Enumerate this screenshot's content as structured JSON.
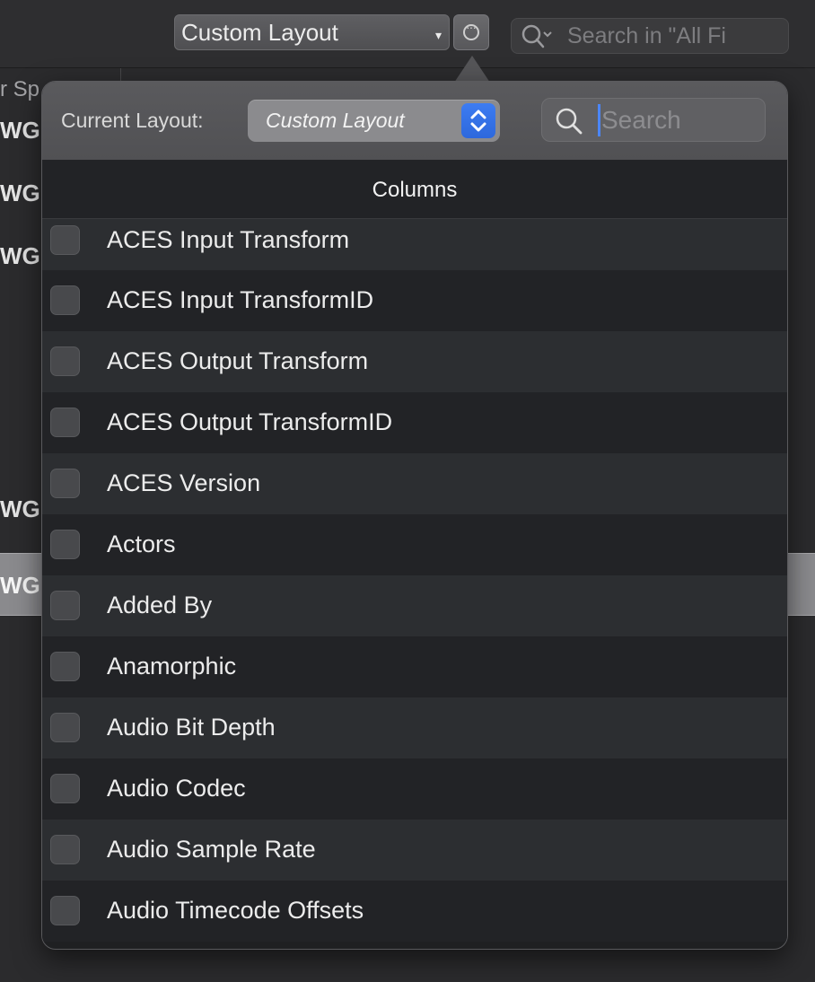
{
  "toolbar": {
    "layout_popup_label": "Custom Layout",
    "search_placeholder": "Search in \"All Fi"
  },
  "background_table": {
    "header_fragment": "r Sp",
    "cells": [
      "WG",
      "WG",
      "WG",
      "WG",
      "WG"
    ]
  },
  "popover": {
    "current_layout_label": "Current Layout:",
    "layout_value": "Custom Layout",
    "search_placeholder": "Search",
    "columns_title": "Columns",
    "items": [
      {
        "label": "ACES Input Transform",
        "checked": false
      },
      {
        "label": "ACES Input TransformID",
        "checked": false
      },
      {
        "label": "ACES Output Transform",
        "checked": false
      },
      {
        "label": "ACES Output TransformID",
        "checked": false
      },
      {
        "label": "ACES Version",
        "checked": false
      },
      {
        "label": "Actors",
        "checked": false
      },
      {
        "label": "Added By",
        "checked": false
      },
      {
        "label": "Anamorphic",
        "checked": false
      },
      {
        "label": "Audio Bit Depth",
        "checked": false
      },
      {
        "label": "Audio Codec",
        "checked": false
      },
      {
        "label": "Audio Sample Rate",
        "checked": false
      },
      {
        "label": "Audio Timecode Offsets",
        "checked": false
      }
    ]
  },
  "colors": {
    "accent": "#3d7cf2",
    "background": "#2b2b2d",
    "popover_header": "#5a5a5d",
    "row_odd": "#2c2e31",
    "row_even": "#222326"
  },
  "icons": {
    "toolbar_search": "search-with-dropdown-icon",
    "layout_more": "ellipsis-circle-icon",
    "layout_stepper": "up-down-chevron-icon",
    "popover_search": "magnifier-icon"
  }
}
